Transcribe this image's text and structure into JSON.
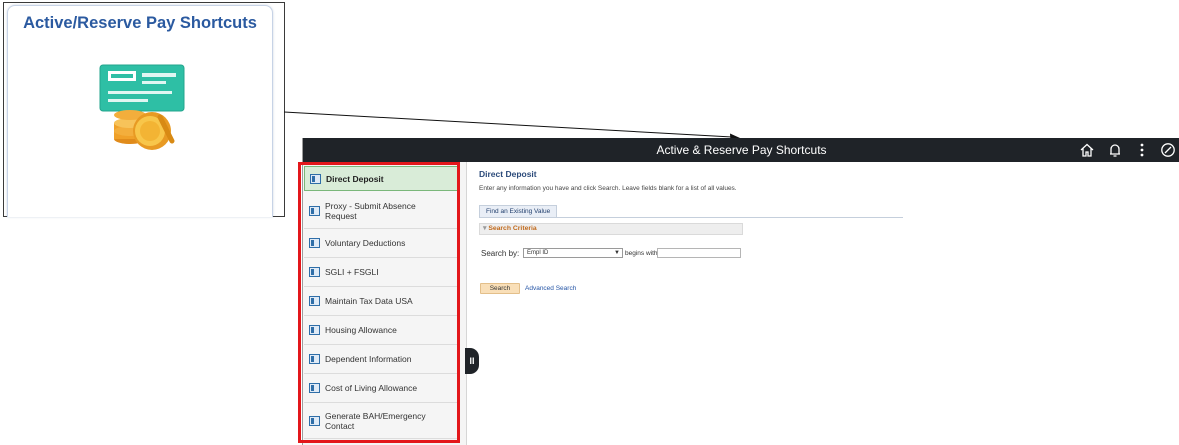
{
  "tile": {
    "title": "Active/Reserve Pay Shortcuts",
    "icon": "check-and-coins-icon"
  },
  "app": {
    "header": {
      "title": "Active & Reserve Pay Shortcuts",
      "icons": [
        "home-icon",
        "bell-icon",
        "more-options-icon",
        "navbar-compass-icon"
      ]
    },
    "sidebar": {
      "items": [
        {
          "label": "Direct Deposit",
          "active": true
        },
        {
          "label": "Proxy - Submit Absence Request"
        },
        {
          "label": "Voluntary Deductions"
        },
        {
          "label": "SGLI + FSGLI"
        },
        {
          "label": "Maintain Tax Data USA"
        },
        {
          "label": "Housing Allowance"
        },
        {
          "label": "Dependent Information"
        },
        {
          "label": "Cost of Living Allowance"
        },
        {
          "label": "Generate BAH/Emergency Contact"
        }
      ]
    },
    "content": {
      "title": "Direct Deposit",
      "instructions": "Enter any information you have and click Search. Leave fields blank for a list of all values.",
      "tab_label": "Find an Existing Value",
      "criteria_label": "Search Criteria",
      "search_by_label": "Search by:",
      "search_by_value": "Empl ID",
      "operator_label": "begins with",
      "search_value": "",
      "search_button": "Search",
      "advanced_link": "Advanced Search"
    }
  },
  "colors": {
    "header_bg": "#1f2328",
    "tile_title": "#2b5aa0",
    "active_item_bg": "#d9ecd8",
    "highlight_border": "#e3171b",
    "search_button_bg": "#f9dfb8",
    "criteria_text": "#c16a1c"
  }
}
